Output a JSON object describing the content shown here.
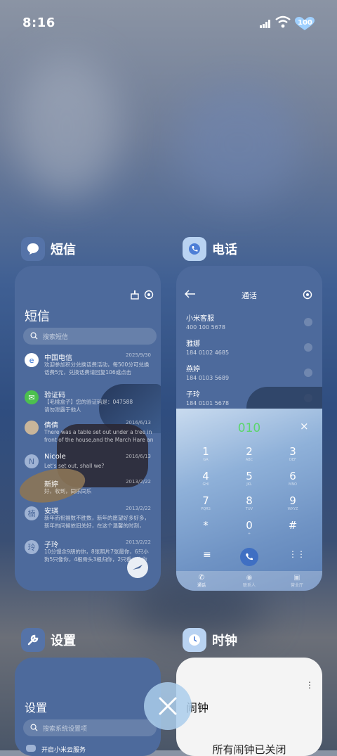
{
  "status": {
    "time": "8:16",
    "battery": "100"
  },
  "apps": {
    "sms": {
      "name": "短信",
      "title": "短信",
      "search_placeholder": "搜索短信",
      "messages": [
        {
          "name": "中国电信",
          "date": "2025/9/30",
          "avatar": "",
          "preview1": "欢迎参加积分兑换话费活动，每500分可兑换",
          "preview2": "话费5元，兑换话费请回复106或点击"
        },
        {
          "name": "验证码",
          "date": "",
          "avatar": "",
          "preview1": "【毛桃盒子】您的验证码是：047588",
          "preview2": "请勿泄露于他人"
        },
        {
          "name": "倩倩",
          "date": "2016/6/13",
          "avatar": "",
          "preview1": "There was a table set out under a tree in",
          "preview2": "front of the house,and the March Hare an..."
        },
        {
          "name": "Nicole",
          "date": "2016/6/13",
          "avatar": "N",
          "preview1": "Let's set out, shall we?",
          "preview2": ""
        },
        {
          "name": "新婷",
          "date": "2013/2/22",
          "avatar": "",
          "preview1": "好，收到，同乐同乐",
          "preview2": ""
        },
        {
          "name": "安琪",
          "date": "2013/2/22",
          "avatar": "楠",
          "preview1": "新年而祝福数不胜数，新年的愿望好多好多，",
          "preview2": "新年的问候依旧关好，在这个温馨的时刻，"
        },
        {
          "name": "子玲",
          "date": "2013/2/22",
          "avatar": "玲",
          "preview1": "10分馒念9朋的你，8张照片7张最你，6只小",
          "preview2": "狗5只像你，4根骨头3根归你，2只看斗狗你"
        }
      ]
    },
    "phone": {
      "name": "电话",
      "title": "通话",
      "contacts": [
        {
          "name": "小米客服",
          "number": "400 100 5678"
        },
        {
          "name": "雅娜",
          "number": "184 0102 4685"
        },
        {
          "name": "燕婷",
          "number": "184 0103 5689"
        },
        {
          "name": "子玲",
          "number": "184 0101 5678"
        }
      ],
      "typed": "010",
      "keys": [
        {
          "d": "1",
          "l": "GA"
        },
        {
          "d": "2",
          "l": "ABC"
        },
        {
          "d": "3",
          "l": "DEF"
        },
        {
          "d": "4",
          "l": "GHI"
        },
        {
          "d": "5",
          "l": "JKL"
        },
        {
          "d": "6",
          "l": "MNO"
        },
        {
          "d": "7",
          "l": "PQRS"
        },
        {
          "d": "8",
          "l": "TUV"
        },
        {
          "d": "9",
          "l": "WXYZ"
        },
        {
          "d": "*",
          "l": ""
        },
        {
          "d": "0",
          "l": "+"
        },
        {
          "d": "#",
          "l": ""
        }
      ],
      "tabs": [
        "通话",
        "联系人",
        "营业厅"
      ]
    },
    "settings": {
      "name": "设置",
      "title": "设置",
      "search_placeholder": "搜索系统设置项",
      "first_item": "开启小米云服务"
    },
    "clock": {
      "name": "时钟",
      "title": "闹钟",
      "status": "所有闹钟已关闭"
    }
  },
  "colors": {
    "accent_green": "#5bd66b",
    "card_blue": "#4d6a9c"
  }
}
